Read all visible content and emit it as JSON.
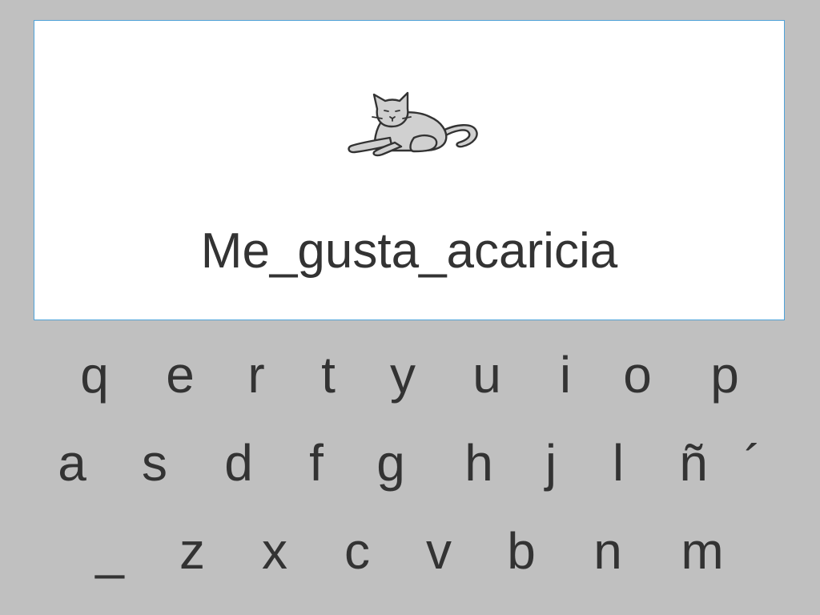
{
  "display": {
    "typed_text": "Me_gusta_acaricia",
    "picture": "cat-pictogram"
  },
  "keyboard": {
    "row1": [
      "q",
      "e",
      "r",
      "t",
      "y",
      "u",
      "i",
      "o",
      "p"
    ],
    "row2": [
      "a",
      "s",
      "d",
      "f",
      "g",
      "h",
      "j",
      "l",
      "ñ",
      "´"
    ],
    "row3": [
      "_",
      "z",
      "x",
      "c",
      "v",
      "b",
      "n",
      "m"
    ]
  },
  "colors": {
    "background": "#c0c0c0",
    "panel": "#ffffff",
    "panel_border": "#4fa3d9",
    "text": "#333333",
    "cat_fill": "#d0d0d0"
  }
}
